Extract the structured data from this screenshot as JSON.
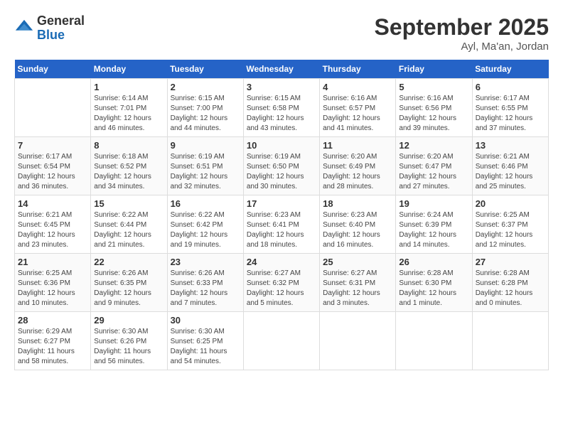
{
  "logo": {
    "general": "General",
    "blue": "Blue"
  },
  "month": "September 2025",
  "location": "Ayl, Ma'an, Jordan",
  "days_header": [
    "Sunday",
    "Monday",
    "Tuesday",
    "Wednesday",
    "Thursday",
    "Friday",
    "Saturday"
  ],
  "weeks": [
    [
      {
        "day": "",
        "sunrise": "",
        "sunset": "",
        "daylight": ""
      },
      {
        "day": "1",
        "sunrise": "Sunrise: 6:14 AM",
        "sunset": "Sunset: 7:01 PM",
        "daylight": "Daylight: 12 hours and 46 minutes."
      },
      {
        "day": "2",
        "sunrise": "Sunrise: 6:15 AM",
        "sunset": "Sunset: 7:00 PM",
        "daylight": "Daylight: 12 hours and 44 minutes."
      },
      {
        "day": "3",
        "sunrise": "Sunrise: 6:15 AM",
        "sunset": "Sunset: 6:58 PM",
        "daylight": "Daylight: 12 hours and 43 minutes."
      },
      {
        "day": "4",
        "sunrise": "Sunrise: 6:16 AM",
        "sunset": "Sunset: 6:57 PM",
        "daylight": "Daylight: 12 hours and 41 minutes."
      },
      {
        "day": "5",
        "sunrise": "Sunrise: 6:16 AM",
        "sunset": "Sunset: 6:56 PM",
        "daylight": "Daylight: 12 hours and 39 minutes."
      },
      {
        "day": "6",
        "sunrise": "Sunrise: 6:17 AM",
        "sunset": "Sunset: 6:55 PM",
        "daylight": "Daylight: 12 hours and 37 minutes."
      }
    ],
    [
      {
        "day": "7",
        "sunrise": "Sunrise: 6:17 AM",
        "sunset": "Sunset: 6:54 PM",
        "daylight": "Daylight: 12 hours and 36 minutes."
      },
      {
        "day": "8",
        "sunrise": "Sunrise: 6:18 AM",
        "sunset": "Sunset: 6:52 PM",
        "daylight": "Daylight: 12 hours and 34 minutes."
      },
      {
        "day": "9",
        "sunrise": "Sunrise: 6:19 AM",
        "sunset": "Sunset: 6:51 PM",
        "daylight": "Daylight: 12 hours and 32 minutes."
      },
      {
        "day": "10",
        "sunrise": "Sunrise: 6:19 AM",
        "sunset": "Sunset: 6:50 PM",
        "daylight": "Daylight: 12 hours and 30 minutes."
      },
      {
        "day": "11",
        "sunrise": "Sunrise: 6:20 AM",
        "sunset": "Sunset: 6:49 PM",
        "daylight": "Daylight: 12 hours and 28 minutes."
      },
      {
        "day": "12",
        "sunrise": "Sunrise: 6:20 AM",
        "sunset": "Sunset: 6:47 PM",
        "daylight": "Daylight: 12 hours and 27 minutes."
      },
      {
        "day": "13",
        "sunrise": "Sunrise: 6:21 AM",
        "sunset": "Sunset: 6:46 PM",
        "daylight": "Daylight: 12 hours and 25 minutes."
      }
    ],
    [
      {
        "day": "14",
        "sunrise": "Sunrise: 6:21 AM",
        "sunset": "Sunset: 6:45 PM",
        "daylight": "Daylight: 12 hours and 23 minutes."
      },
      {
        "day": "15",
        "sunrise": "Sunrise: 6:22 AM",
        "sunset": "Sunset: 6:44 PM",
        "daylight": "Daylight: 12 hours and 21 minutes."
      },
      {
        "day": "16",
        "sunrise": "Sunrise: 6:22 AM",
        "sunset": "Sunset: 6:42 PM",
        "daylight": "Daylight: 12 hours and 19 minutes."
      },
      {
        "day": "17",
        "sunrise": "Sunrise: 6:23 AM",
        "sunset": "Sunset: 6:41 PM",
        "daylight": "Daylight: 12 hours and 18 minutes."
      },
      {
        "day": "18",
        "sunrise": "Sunrise: 6:23 AM",
        "sunset": "Sunset: 6:40 PM",
        "daylight": "Daylight: 12 hours and 16 minutes."
      },
      {
        "day": "19",
        "sunrise": "Sunrise: 6:24 AM",
        "sunset": "Sunset: 6:39 PM",
        "daylight": "Daylight: 12 hours and 14 minutes."
      },
      {
        "day": "20",
        "sunrise": "Sunrise: 6:25 AM",
        "sunset": "Sunset: 6:37 PM",
        "daylight": "Daylight: 12 hours and 12 minutes."
      }
    ],
    [
      {
        "day": "21",
        "sunrise": "Sunrise: 6:25 AM",
        "sunset": "Sunset: 6:36 PM",
        "daylight": "Daylight: 12 hours and 10 minutes."
      },
      {
        "day": "22",
        "sunrise": "Sunrise: 6:26 AM",
        "sunset": "Sunset: 6:35 PM",
        "daylight": "Daylight: 12 hours and 9 minutes."
      },
      {
        "day": "23",
        "sunrise": "Sunrise: 6:26 AM",
        "sunset": "Sunset: 6:33 PM",
        "daylight": "Daylight: 12 hours and 7 minutes."
      },
      {
        "day": "24",
        "sunrise": "Sunrise: 6:27 AM",
        "sunset": "Sunset: 6:32 PM",
        "daylight": "Daylight: 12 hours and 5 minutes."
      },
      {
        "day": "25",
        "sunrise": "Sunrise: 6:27 AM",
        "sunset": "Sunset: 6:31 PM",
        "daylight": "Daylight: 12 hours and 3 minutes."
      },
      {
        "day": "26",
        "sunrise": "Sunrise: 6:28 AM",
        "sunset": "Sunset: 6:30 PM",
        "daylight": "Daylight: 12 hours and 1 minute."
      },
      {
        "day": "27",
        "sunrise": "Sunrise: 6:28 AM",
        "sunset": "Sunset: 6:28 PM",
        "daylight": "Daylight: 12 hours and 0 minutes."
      }
    ],
    [
      {
        "day": "28",
        "sunrise": "Sunrise: 6:29 AM",
        "sunset": "Sunset: 6:27 PM",
        "daylight": "Daylight: 11 hours and 58 minutes."
      },
      {
        "day": "29",
        "sunrise": "Sunrise: 6:30 AM",
        "sunset": "Sunset: 6:26 PM",
        "daylight": "Daylight: 11 hours and 56 minutes."
      },
      {
        "day": "30",
        "sunrise": "Sunrise: 6:30 AM",
        "sunset": "Sunset: 6:25 PM",
        "daylight": "Daylight: 11 hours and 54 minutes."
      },
      {
        "day": "",
        "sunrise": "",
        "sunset": "",
        "daylight": ""
      },
      {
        "day": "",
        "sunrise": "",
        "sunset": "",
        "daylight": ""
      },
      {
        "day": "",
        "sunrise": "",
        "sunset": "",
        "daylight": ""
      },
      {
        "day": "",
        "sunrise": "",
        "sunset": "",
        "daylight": ""
      }
    ]
  ]
}
